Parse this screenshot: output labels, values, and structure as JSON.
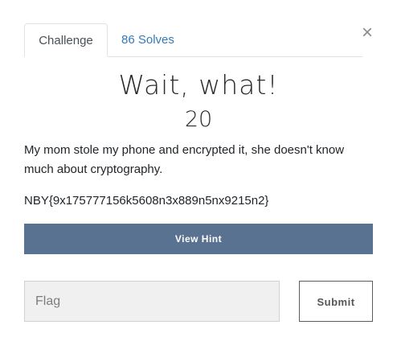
{
  "modal": {
    "close_glyph": "×",
    "close_icon": "close-icon"
  },
  "tabs": [
    {
      "label": "Challenge",
      "active": true
    },
    {
      "label": "86 Solves",
      "active": false
    }
  ],
  "challenge": {
    "name": "Wait, what!",
    "value": "20",
    "description": "My mom stole my phone and encrypted it, she doesn't know much about cryptography.",
    "ciphertext": "NBY{9x175777156k5608n3x889n5nx9215n2}"
  },
  "hint": {
    "label": "View Hint"
  },
  "flag_form": {
    "placeholder": "Flag",
    "value": "",
    "submit_label": "Submit"
  },
  "colors": {
    "hint_button_bg": "#5a7291",
    "link_blue": "#337ab7",
    "input_bg": "#f0f0f0"
  }
}
